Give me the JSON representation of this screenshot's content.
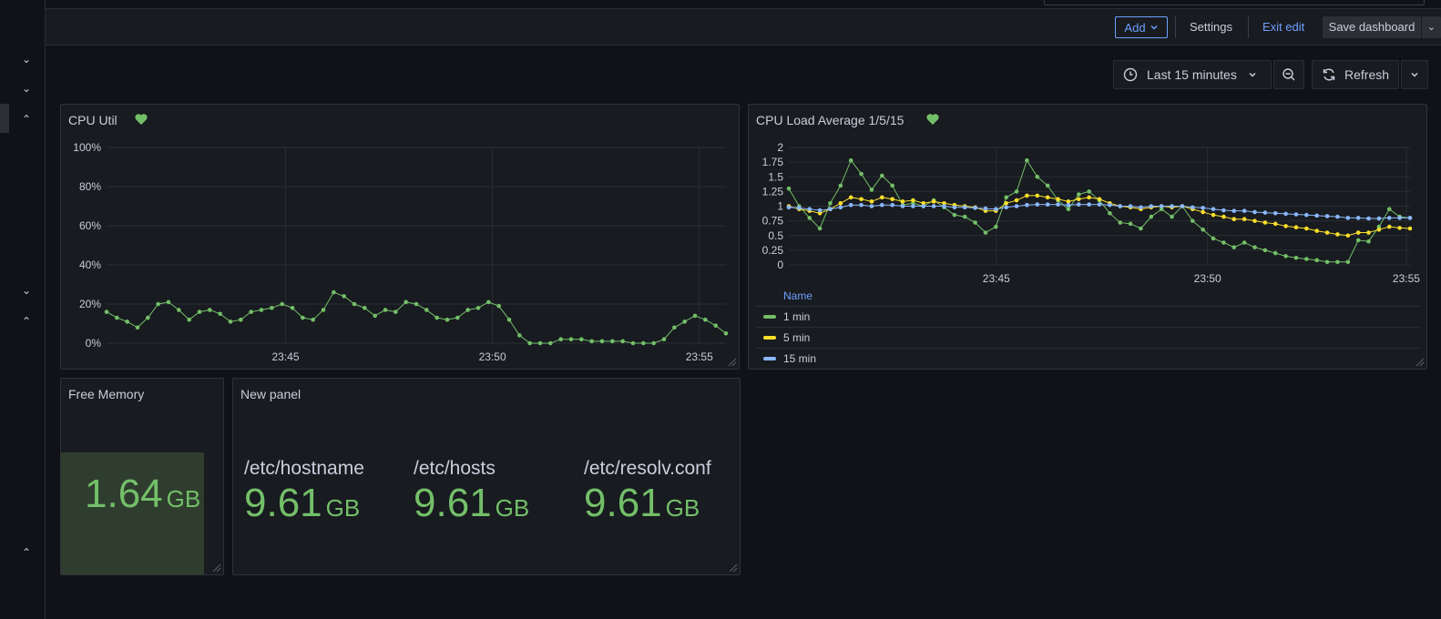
{
  "toolbar": {
    "add_label": "Add",
    "settings_label": "Settings",
    "exit_edit_label": "Exit edit",
    "save_label": "Save dashboard"
  },
  "timepicker": {
    "range_label": "Last 15 minutes",
    "refresh_label": "Refresh"
  },
  "colors": {
    "green": "#73bf69",
    "yellow": "#fade2a",
    "blue": "#8ab8ff",
    "link": "#6e9fff"
  },
  "panels": {
    "cpu_util": {
      "title": "CPU Util",
      "chart_data": {
        "type": "line",
        "ylim": [
          0,
          100
        ],
        "yticks": [
          "100%",
          "80%",
          "60%",
          "40%",
          "20%",
          "0%"
        ],
        "xticks": [
          "23:45",
          "23:50",
          "23:55"
        ],
        "series": [
          {
            "color": "#73bf69",
            "values": [
              16,
              13,
              11,
              8,
              13,
              20,
              21,
              17,
              12,
              16,
              17,
              15,
              11,
              12,
              16,
              17,
              18,
              20,
              18,
              13,
              12,
              17,
              26,
              24,
              20,
              18,
              14,
              17,
              16,
              21,
              20,
              17,
              13,
              12,
              13,
              17,
              18,
              21,
              19,
              12,
              4,
              0,
              0,
              0,
              2,
              2,
              2,
              1,
              1,
              1,
              1,
              0,
              0,
              0,
              2,
              8,
              11,
              14,
              12,
              9,
              5
            ]
          }
        ]
      }
    },
    "cpu_load": {
      "title": "CPU Load Average 1/5/15",
      "legend_header": "Name",
      "chart_data": {
        "type": "line",
        "ylim": [
          0,
          2
        ],
        "yticks": [
          "2",
          "1.75",
          "1.5",
          "1.25",
          "1",
          "0.75",
          "0.5",
          "0.25",
          "0"
        ],
        "xticks": [
          "23:45",
          "23:50",
          "23:55"
        ],
        "series": [
          {
            "name": "1 min",
            "color": "#73bf69",
            "values": [
              1.3,
              1.0,
              0.8,
              0.62,
              1.05,
              1.35,
              1.78,
              1.55,
              1.28,
              1.52,
              1.35,
              1.02,
              1.05,
              1.0,
              1.1,
              0.98,
              0.85,
              0.82,
              0.72,
              0.55,
              0.65,
              1.15,
              1.25,
              1.78,
              1.5,
              1.35,
              1.1,
              0.95,
              1.2,
              1.25,
              1.1,
              0.88,
              0.72,
              0.7,
              0.62,
              0.82,
              0.95,
              0.82,
              1.0,
              0.75,
              0.6,
              0.45,
              0.38,
              0.3,
              0.38,
              0.3,
              0.25,
              0.2,
              0.15,
              0.12,
              0.1,
              0.08,
              0.05,
              0.05,
              0.05,
              0.42,
              0.4,
              0.65,
              0.95,
              0.82,
              0.8
            ]
          },
          {
            "name": "5 min",
            "color": "#fade2a",
            "values": [
              1.0,
              0.95,
              0.92,
              0.88,
              0.95,
              1.05,
              1.15,
              1.12,
              1.08,
              1.15,
              1.12,
              1.08,
              1.1,
              1.05,
              1.08,
              1.05,
              1.02,
              1.0,
              0.98,
              0.92,
              0.92,
              1.05,
              1.1,
              1.18,
              1.18,
              1.15,
              1.12,
              1.08,
              1.12,
              1.15,
              1.12,
              1.05,
              1.0,
              0.98,
              0.95,
              0.98,
              1.0,
              0.98,
              1.0,
              0.95,
              0.9,
              0.85,
              0.82,
              0.78,
              0.78,
              0.75,
              0.72,
              0.7,
              0.66,
              0.64,
              0.62,
              0.58,
              0.55,
              0.52,
              0.5,
              0.55,
              0.55,
              0.6,
              0.65,
              0.63,
              0.62
            ]
          },
          {
            "name": "15 min",
            "color": "#8ab8ff",
            "values": [
              0.98,
              0.97,
              0.95,
              0.93,
              0.95,
              0.98,
              1.02,
              1.02,
              1.0,
              1.02,
              1.02,
              1.0,
              1.0,
              1.0,
              1.0,
              1.0,
              0.98,
              0.98,
              0.97,
              0.96,
              0.95,
              0.98,
              1.0,
              1.02,
              1.03,
              1.03,
              1.03,
              1.02,
              1.03,
              1.03,
              1.03,
              1.02,
              1.0,
              1.0,
              0.98,
              1.0,
              1.0,
              1.0,
              1.0,
              0.98,
              0.97,
              0.95,
              0.93,
              0.92,
              0.92,
              0.9,
              0.89,
              0.88,
              0.87,
              0.86,
              0.85,
              0.84,
              0.83,
              0.82,
              0.8,
              0.8,
              0.79,
              0.79,
              0.8,
              0.8,
              0.8
            ]
          }
        ]
      }
    },
    "free_memory": {
      "title": "Free Memory",
      "value": "1.64",
      "unit": "GB"
    },
    "new_panel": {
      "title": "New panel",
      "stats": [
        {
          "label": "/etc/hostname",
          "value": "9.61",
          "unit": "GB"
        },
        {
          "label": "/etc/hosts",
          "value": "9.61",
          "unit": "GB"
        },
        {
          "label": "/etc/resolv.conf",
          "value": "9.61",
          "unit": "GB"
        }
      ]
    }
  }
}
